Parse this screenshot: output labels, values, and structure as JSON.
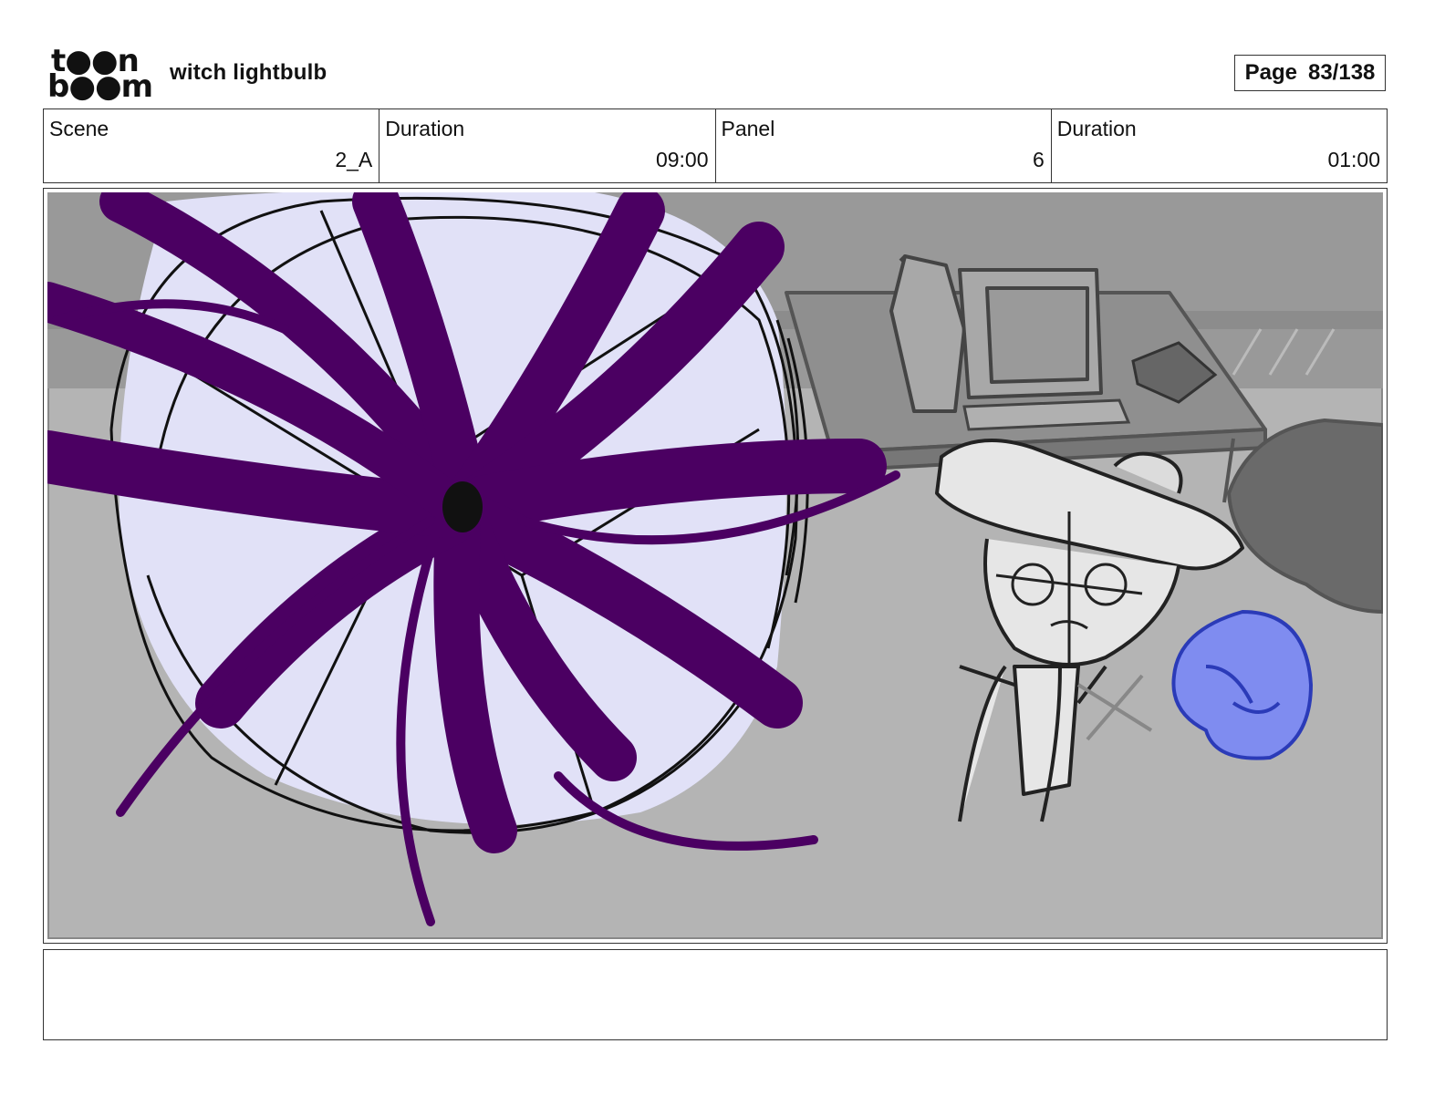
{
  "header": {
    "logo_line1": "t●●n",
    "logo_line2": "b●●m",
    "project_title": "witch lightbulb",
    "page_label": "Page",
    "page_value": "83/138"
  },
  "info": {
    "scene_label": "Scene",
    "scene_value": "2_A",
    "scene_duration_label": "Duration",
    "scene_duration_value": "09:00",
    "panel_label": "Panel",
    "panel_value": "6",
    "panel_duration_label": "Duration",
    "panel_duration_value": "01:00"
  },
  "notes": {
    "text": ""
  },
  "colors": {
    "vortex_purple": "#4b0062",
    "glow_lavender": "#e1e1f7",
    "background_gray": "#b4b4b4",
    "wall_gray": "#989898",
    "blue_creature": "#7f8cf0"
  }
}
